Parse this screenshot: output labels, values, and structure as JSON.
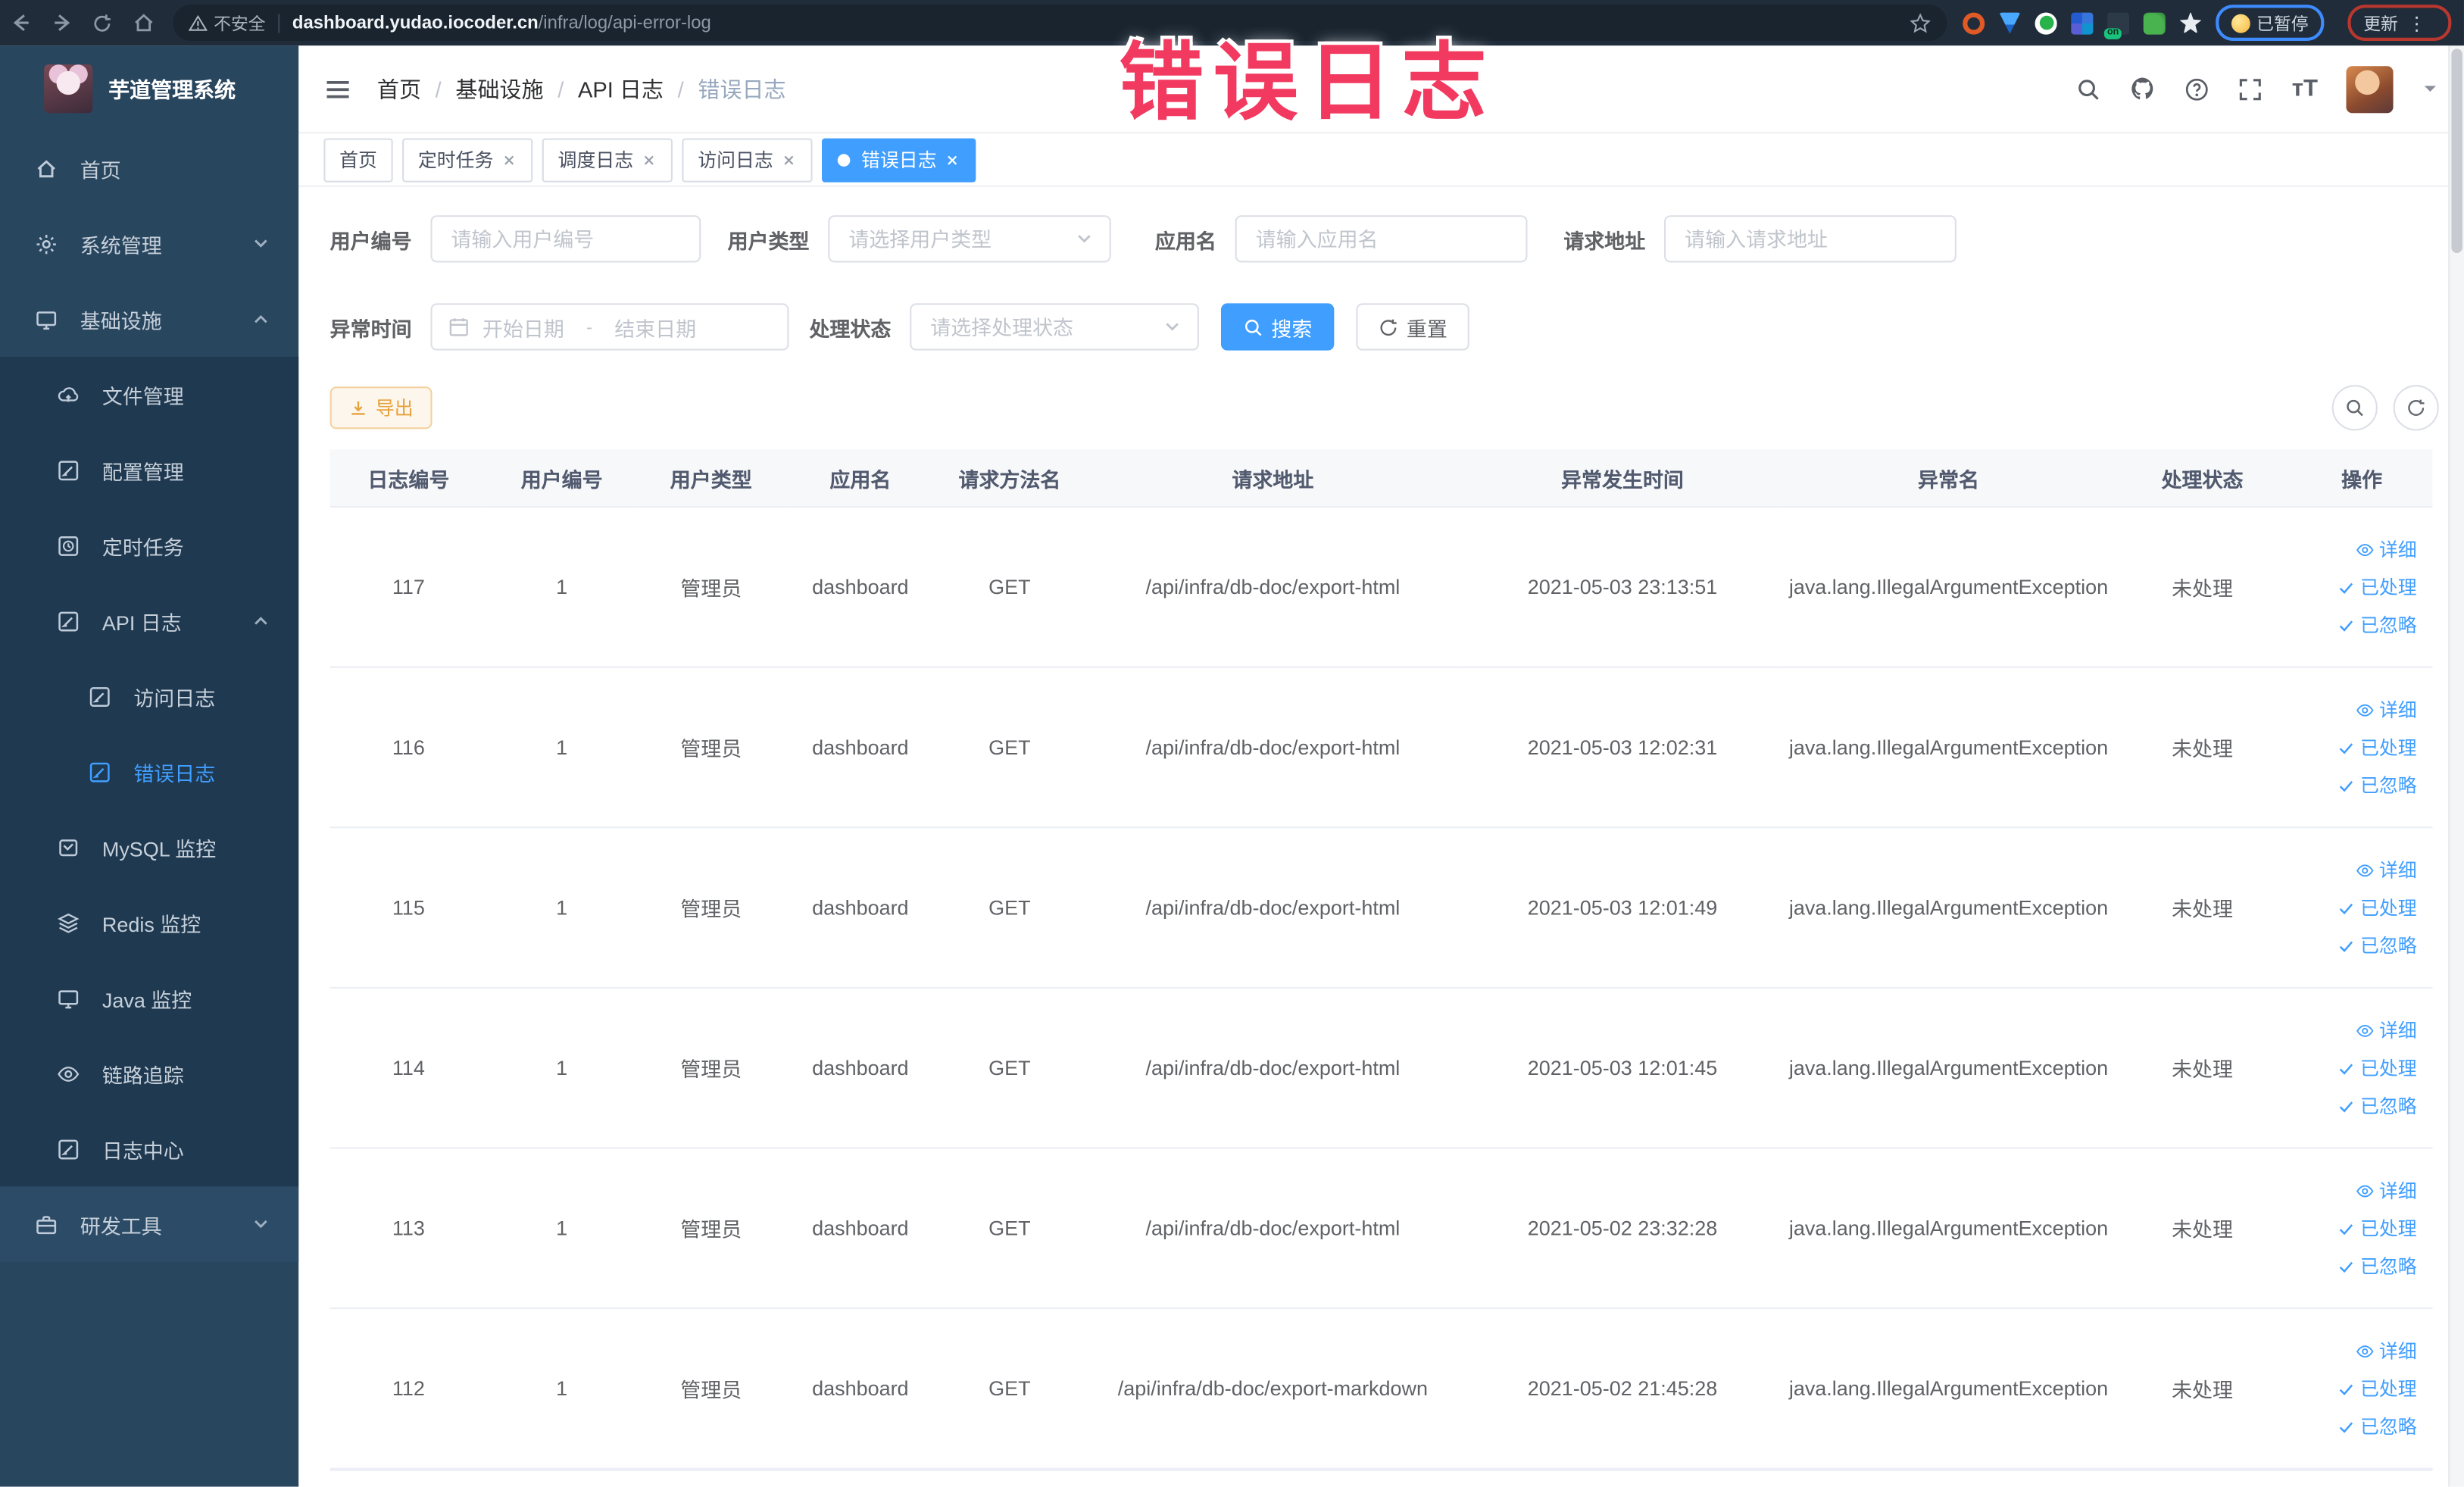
{
  "overlay": {
    "text": "错误日志"
  },
  "browser": {
    "security_label": "不安全",
    "url_host": "dashboard.yudao.iocoder.cn",
    "url_path": "/infra/log/api-error-log",
    "paused_pill": "已暂停",
    "update_pill": "更新"
  },
  "sidebar": {
    "app_title": "芋道管理系统",
    "items": [
      {
        "label": "首页"
      },
      {
        "label": "系统管理"
      },
      {
        "label": "基础设施"
      },
      {
        "label": "文件管理"
      },
      {
        "label": "配置管理"
      },
      {
        "label": "定时任务"
      },
      {
        "label": "API 日志"
      },
      {
        "label": "访问日志"
      },
      {
        "label": "错误日志"
      },
      {
        "label": "MySQL 监控"
      },
      {
        "label": "Redis 监控"
      },
      {
        "label": "Java 监控"
      },
      {
        "label": "链路追踪"
      },
      {
        "label": "日志中心"
      },
      {
        "label": "研发工具"
      }
    ]
  },
  "header": {
    "breadcrumb": [
      "首页",
      "基础设施",
      "API 日志",
      "错误日志"
    ]
  },
  "tabs": [
    {
      "label": "首页"
    },
    {
      "label": "定时任务"
    },
    {
      "label": "调度日志"
    },
    {
      "label": "访问日志"
    },
    {
      "label": "错误日志"
    }
  ],
  "filters": {
    "user_id": {
      "label": "用户编号",
      "placeholder": "请输入用户编号"
    },
    "user_type": {
      "label": "用户类型",
      "placeholder": "请选择用户类型"
    },
    "app_name": {
      "label": "应用名",
      "placeholder": "请输入应用名"
    },
    "request_url": {
      "label": "请求地址",
      "placeholder": "请输入请求地址"
    },
    "exception_time": {
      "label": "异常时间",
      "start_placeholder": "开始日期",
      "separator": "-",
      "end_placeholder": "结束日期"
    },
    "process_status": {
      "label": "处理状态",
      "placeholder": "请选择处理状态"
    },
    "search_label": "搜索",
    "reset_label": "重置"
  },
  "toolbar": {
    "export_label": "导出"
  },
  "table": {
    "columns": [
      "日志编号",
      "用户编号",
      "用户类型",
      "应用名",
      "请求方法名",
      "请求地址",
      "异常发生时间",
      "异常名",
      "处理状态",
      "操作"
    ],
    "action_labels": {
      "detail": "详细",
      "processed": "已处理",
      "ignored": "已忽略"
    },
    "rows": [
      {
        "id": "117",
        "user_id": "1",
        "user_type": "管理员",
        "app": "dashboard",
        "method": "GET",
        "url": "/api/infra/db-doc/export-html",
        "time": "2021-05-03 23:13:51",
        "exception": "java.lang.IllegalArgumentException",
        "status": "未处理"
      },
      {
        "id": "116",
        "user_id": "1",
        "user_type": "管理员",
        "app": "dashboard",
        "method": "GET",
        "url": "/api/infra/db-doc/export-html",
        "time": "2021-05-03 12:02:31",
        "exception": "java.lang.IllegalArgumentException",
        "status": "未处理"
      },
      {
        "id": "115",
        "user_id": "1",
        "user_type": "管理员",
        "app": "dashboard",
        "method": "GET",
        "url": "/api/infra/db-doc/export-html",
        "time": "2021-05-03 12:01:49",
        "exception": "java.lang.IllegalArgumentException",
        "status": "未处理"
      },
      {
        "id": "114",
        "user_id": "1",
        "user_type": "管理员",
        "app": "dashboard",
        "method": "GET",
        "url": "/api/infra/db-doc/export-html",
        "time": "2021-05-03 12:01:45",
        "exception": "java.lang.IllegalArgumentException",
        "status": "未处理"
      },
      {
        "id": "113",
        "user_id": "1",
        "user_type": "管理员",
        "app": "dashboard",
        "method": "GET",
        "url": "/api/infra/db-doc/export-html",
        "time": "2021-05-02 23:32:28",
        "exception": "java.lang.IllegalArgumentException",
        "status": "未处理"
      },
      {
        "id": "112",
        "user_id": "1",
        "user_type": "管理员",
        "app": "dashboard",
        "method": "GET",
        "url": "/api/infra/db-doc/export-markdown",
        "time": "2021-05-02 21:45:28",
        "exception": "java.lang.IllegalArgumentException",
        "status": "未处理"
      }
    ]
  },
  "colors": {
    "accent": "#409eff",
    "warning": "#e6a23c",
    "overlay_pink": "#f23a60",
    "sidebar_bg": "#29465f",
    "submenu_bg": "#1f3950"
  }
}
